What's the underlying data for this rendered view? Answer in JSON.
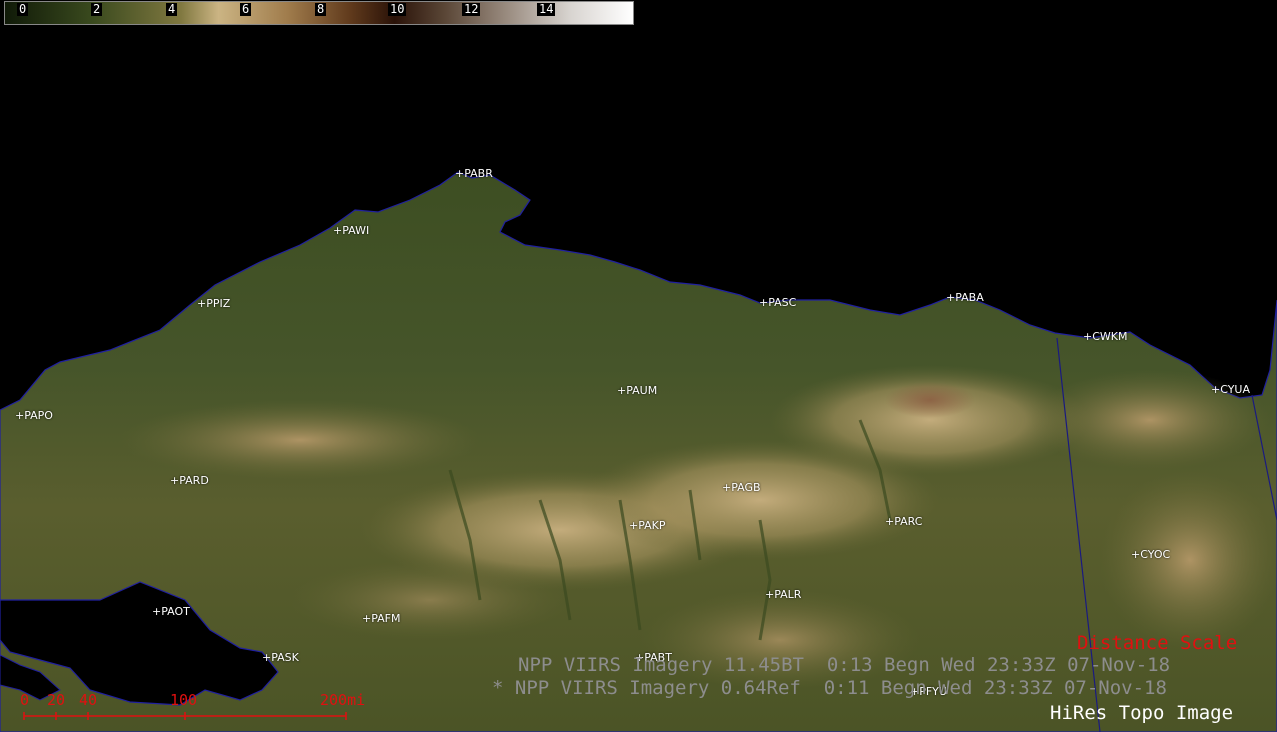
{
  "colorbar": {
    "ticks": [
      "0",
      "2",
      "4",
      "6",
      "8",
      "10",
      "12",
      "14"
    ]
  },
  "stations": [
    {
      "id": "PABR"
    },
    {
      "id": "PAWI"
    },
    {
      "id": "PPIZ"
    },
    {
      "id": "PASC"
    },
    {
      "id": "PABA"
    },
    {
      "id": "CWKM"
    },
    {
      "id": "CYUA"
    },
    {
      "id": "PAPO"
    },
    {
      "id": "PAUM"
    },
    {
      "id": "PARD"
    },
    {
      "id": "PAGB"
    },
    {
      "id": "PAKP"
    },
    {
      "id": "PARC"
    },
    {
      "id": "CYOC"
    },
    {
      "id": "PALR"
    },
    {
      "id": "PAOT"
    },
    {
      "id": "PAFM"
    },
    {
      "id": "PASK"
    },
    {
      "id": "PABT"
    },
    {
      "id": "PFYU"
    }
  ],
  "legend": {
    "distance_scale": "Distance Scale",
    "imagery_line1": "NPP VIIRS Imagery 11.45BT  0:13 Begn Wed 23:33Z 07-Nov-18",
    "imagery_line2": "* NPP VIIRS Imagery 0.64Ref  0:11 Begn Wed 23:33Z 07-Nov-18",
    "topo": "HiRes Topo Image"
  },
  "scale_bar": {
    "labels": [
      "0",
      "20",
      "40",
      "100",
      "200mi"
    ]
  },
  "colors": {
    "background": "#000000",
    "coastline": "#2020a0",
    "distance_scale": "#e01010",
    "imagery_text": "#8d8d8d"
  }
}
